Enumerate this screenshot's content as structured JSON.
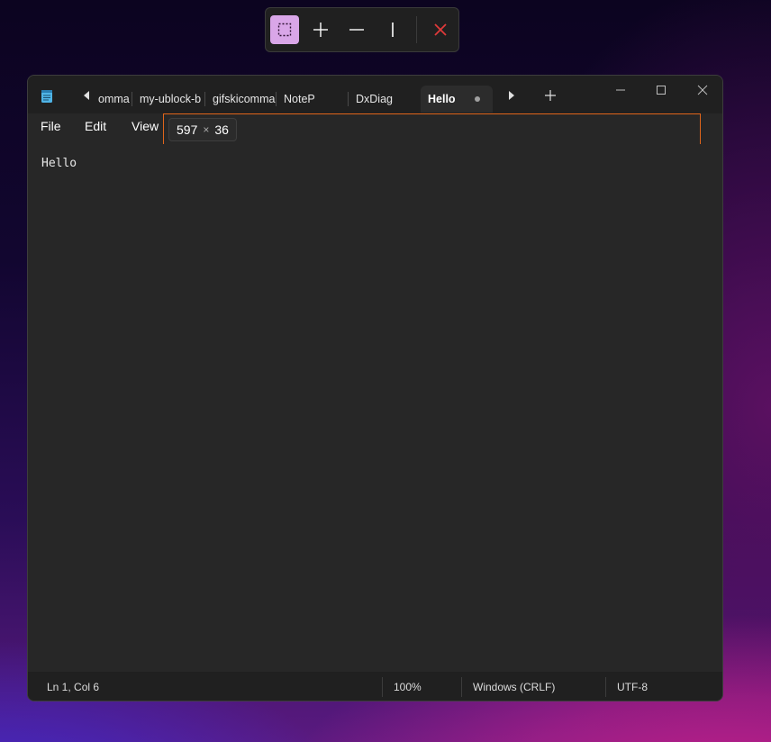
{
  "snip_toolbar": {
    "buttons": [
      {
        "icon": "rectangle-select-icon",
        "active": true
      },
      {
        "icon": "crosshair-icon",
        "active": false
      },
      {
        "icon": "horizontal-line-icon",
        "active": false
      },
      {
        "icon": "vertical-line-icon",
        "active": false
      },
      {
        "icon": "close-icon",
        "active": false
      }
    ],
    "close_color": "#e03a3a"
  },
  "window": {
    "tabs": [
      {
        "label": "omma"
      },
      {
        "label": "my-ublock-b"
      },
      {
        "label": "gifskicomma"
      },
      {
        "label": "NoteP"
      },
      {
        "label": "DxDiag"
      },
      {
        "label": "Hello",
        "active": true,
        "unsaved": true
      }
    ],
    "menu": {
      "file": "File",
      "edit": "Edit",
      "view": "View"
    },
    "selection": {
      "width": "597",
      "times": "×",
      "height": "36"
    },
    "editor_text": "Hello",
    "status": {
      "position": "Ln 1, Col 6",
      "zoom": "100%",
      "line_ending": "Windows (CRLF)",
      "encoding": "UTF-8"
    }
  },
  "colors": {
    "selection_border": "#e0651b",
    "active_tool_bg": "#d9a6e8"
  }
}
